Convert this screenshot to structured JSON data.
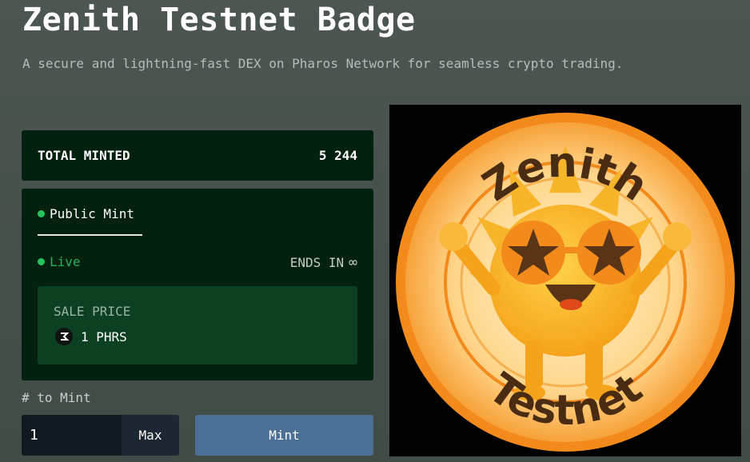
{
  "page": {
    "title": "Zenith Testnet Badge",
    "subtitle": "A secure and lightning-fast DEX on Pharos Network for seamless crypto trading."
  },
  "minted": {
    "label": "TOTAL MINTED",
    "count": "5 244"
  },
  "phase": {
    "tab_label": "Public Mint",
    "status": "Live",
    "ends_label": "ENDS IN",
    "ends_value": "∞",
    "sale_label": "SALE PRICE",
    "price": "1 PHRS"
  },
  "mint_form": {
    "quantity_label": "# to Mint",
    "quantity_value": "1",
    "max_label": "Max",
    "mint_label": "Mint"
  },
  "badge": {
    "top_text": "Zenith",
    "bottom_text": "Testnet"
  },
  "colors": {
    "accent_green": "#22c55e",
    "mint_button": "#4c6f96",
    "panel_bg": "#04200f",
    "sale_bg": "#0b4120"
  }
}
